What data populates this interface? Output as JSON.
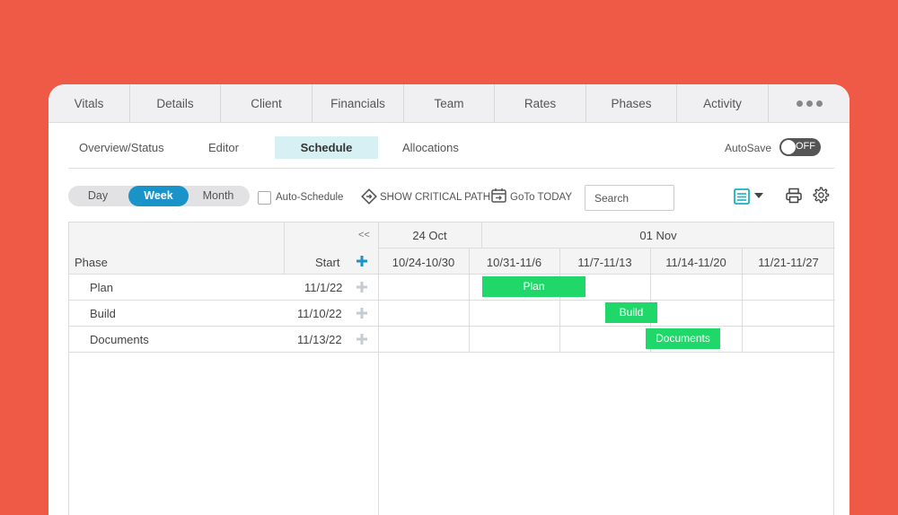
{
  "tabs": [
    "Vitals",
    "Details",
    "Client",
    "Financials",
    "Team",
    "Rates",
    "Phases",
    "Activity"
  ],
  "subnav": {
    "items": [
      "Overview/Status",
      "Editor",
      "Schedule",
      "Allocations"
    ],
    "active": "Schedule",
    "autosave_label": "AutoSave",
    "autosave_state": "OFF"
  },
  "toolbar": {
    "view_modes": [
      "Day",
      "Week",
      "Month"
    ],
    "active_view": "Week",
    "auto_schedule_label": "Auto-Schedule",
    "critical_path_label": "SHOW CRITICAL PATH",
    "goto_today_label": "GoTo TODAY",
    "search_placeholder": "Search"
  },
  "grid": {
    "collapse_label": "<<",
    "phase_header": "Phase",
    "start_header": "Start",
    "month_headers": [
      "24 Oct",
      "01 Nov"
    ],
    "week_headers": [
      "10/24-10/30",
      "10/31-11/6",
      "11/7-11/13",
      "11/14-11/20",
      "11/21-11/27"
    ],
    "rows": [
      {
        "phase": "Plan",
        "start": "11/1/22",
        "bar_label": "Plan"
      },
      {
        "phase": "Build",
        "start": "11/10/22",
        "bar_label": "Build"
      },
      {
        "phase": "Documents",
        "start": "11/13/22",
        "bar_label": "Documents"
      }
    ]
  },
  "colors": {
    "background": "#ef5a47",
    "accent": "#1a93c8",
    "bar": "#20d86a",
    "teal_icon": "#17b3c2"
  }
}
